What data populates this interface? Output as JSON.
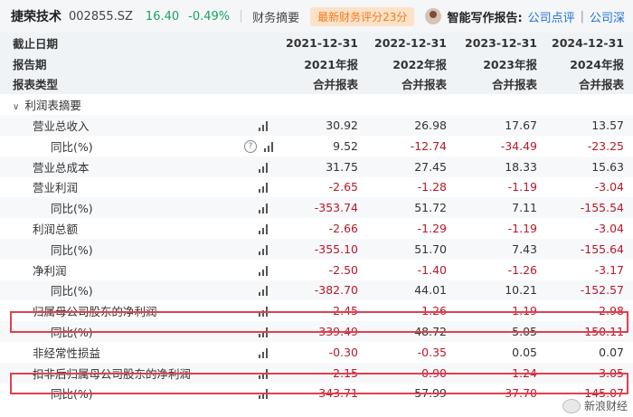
{
  "header": {
    "stock_name": "捷荣技术",
    "stock_code": "002855.SZ",
    "price": "16.40",
    "change": "-0.49%",
    "section_label": "财务摘要",
    "badge": "最新财务评分23分",
    "smart_label": "智能写作报告:",
    "link_review": "公司点评",
    "link_more": "公司深"
  },
  "table": {
    "row_labels": {
      "date": "截止日期",
      "period": "报告期",
      "type": "报表类型"
    },
    "columns": [
      {
        "date": "2021-12-31",
        "period": "2021年报",
        "type": "合并报表"
      },
      {
        "date": "2022-12-31",
        "period": "2022年报",
        "type": "合并报表"
      },
      {
        "date": "2023-12-31",
        "period": "2023年报",
        "type": "合并报表"
      },
      {
        "date": "2024-12-31",
        "period": "2024年报",
        "type": "合并报表"
      }
    ],
    "section": "利润表摘要",
    "rows": [
      {
        "label": "营业总收入",
        "values": [
          "30.92",
          "26.98",
          "17.67",
          "13.57"
        ]
      },
      {
        "label": "同比(%)",
        "values": [
          "9.52",
          "-12.74",
          "-34.49",
          "-23.25"
        ]
      },
      {
        "label": "营业总成本",
        "values": [
          "31.75",
          "27.45",
          "18.33",
          "15.63"
        ]
      },
      {
        "label": "营业利润",
        "values": [
          "-2.65",
          "-1.28",
          "-1.19",
          "-3.04"
        ]
      },
      {
        "label": "同比(%)",
        "values": [
          "-353.74",
          "51.72",
          "7.11",
          "-155.54"
        ]
      },
      {
        "label": "利润总额",
        "values": [
          "-2.66",
          "-1.29",
          "-1.19",
          "-3.04"
        ]
      },
      {
        "label": "同比(%)",
        "values": [
          "-355.10",
          "51.70",
          "7.43",
          "-155.64"
        ]
      },
      {
        "label": "净利润",
        "values": [
          "-2.50",
          "-1.40",
          "-1.26",
          "-3.17"
        ]
      },
      {
        "label": "同比(%)",
        "values": [
          "-382.70",
          "44.01",
          "10.21",
          "-152.57"
        ]
      },
      {
        "label": "归属母公司股东的净利润",
        "values": [
          "-2.45",
          "-1.26",
          "-1.19",
          "-2.98"
        ]
      },
      {
        "label": "同比(%)",
        "values": [
          "-339.49",
          "48.72",
          "5.05",
          "-150.11"
        ]
      },
      {
        "label": "非经常性损益",
        "values": [
          "-0.30",
          "-0.35",
          "0.05",
          "0.07"
        ]
      },
      {
        "label": "扣非后归属母公司股东的净利润",
        "values": [
          "-2.15",
          "-0.90",
          "-1.24",
          "-3.05"
        ]
      },
      {
        "label": "同比(%)",
        "values": [
          "-343.71",
          "57.99",
          "-37.70",
          "-145.07"
        ]
      }
    ]
  },
  "watermark": "新浪财经",
  "colors": {
    "negative": "#b8182a",
    "positive_quote": "#1aa260",
    "highlight_box": "#e0404e"
  }
}
